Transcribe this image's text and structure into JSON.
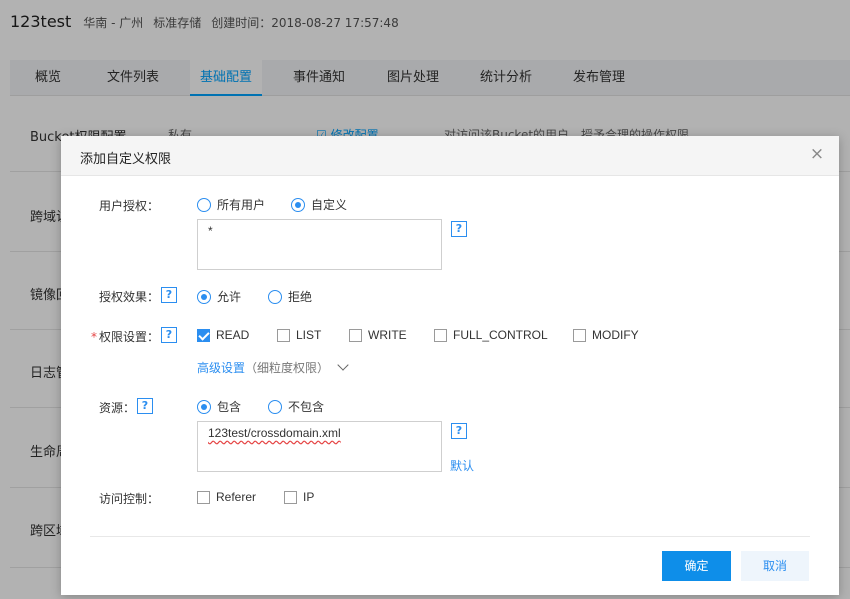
{
  "page": {
    "bucket_name": "123test",
    "region": "华南 - 广州",
    "storage_class": "标准存储",
    "created": "创建时间：2018-08-27 17:57:48"
  },
  "tabs": [
    {
      "label": "概览"
    },
    {
      "label": "文件列表"
    },
    {
      "label": "基础配置",
      "active": true
    },
    {
      "label": "事件通知"
    },
    {
      "label": "图片处理"
    },
    {
      "label": "统计分析"
    },
    {
      "label": "发布管理"
    }
  ],
  "settings_rows": [
    {
      "label": "Bucket权限配置",
      "value": "私有",
      "action": "修改配置",
      "desc": "对访问该Bucket的用户，授予合理的操作权限"
    },
    {
      "label": "跨域访"
    },
    {
      "label": "镜像回"
    },
    {
      "label": "日志管"
    },
    {
      "label": "生命周"
    },
    {
      "label": "跨区域"
    }
  ],
  "dialog": {
    "title": "添加自定义权限",
    "close_icon": "×",
    "user_auth": {
      "label": "用户授权：",
      "options": [
        {
          "label": "所有用户",
          "selected": false
        },
        {
          "label": "自定义",
          "selected": true
        }
      ],
      "value": "*"
    },
    "effect": {
      "label": "授权效果：",
      "options": [
        {
          "label": "允许",
          "selected": true
        },
        {
          "label": "拒绝",
          "selected": false
        }
      ]
    },
    "permissions": {
      "required_mark": "*",
      "label": "权限设置：",
      "options": [
        {
          "label": "READ",
          "checked": true
        },
        {
          "label": "LIST",
          "checked": false
        },
        {
          "label": "WRITE",
          "checked": false
        },
        {
          "label": "FULL_CONTROL",
          "checked": false
        },
        {
          "label": "MODIFY",
          "checked": false
        }
      ],
      "advanced_label": "高级设置",
      "advanced_sub": "（细粒度权限）"
    },
    "resource": {
      "label": "资源：",
      "options": [
        {
          "label": "包含",
          "selected": true
        },
        {
          "label": "不包含",
          "selected": false
        }
      ],
      "value": "123test/crossdomain.xml",
      "default_link": "默认"
    },
    "access_control": {
      "label": "访问控制：",
      "options": [
        {
          "label": "Referer",
          "checked": false
        },
        {
          "label": "IP",
          "checked": false
        }
      ]
    },
    "help_glyph": "?",
    "confirm_label": "确定",
    "cancel_label": "取消"
  },
  "colors": {
    "accent": "#2b8ef0",
    "primary_button": "#0e8ee9",
    "required": "#e54545"
  }
}
